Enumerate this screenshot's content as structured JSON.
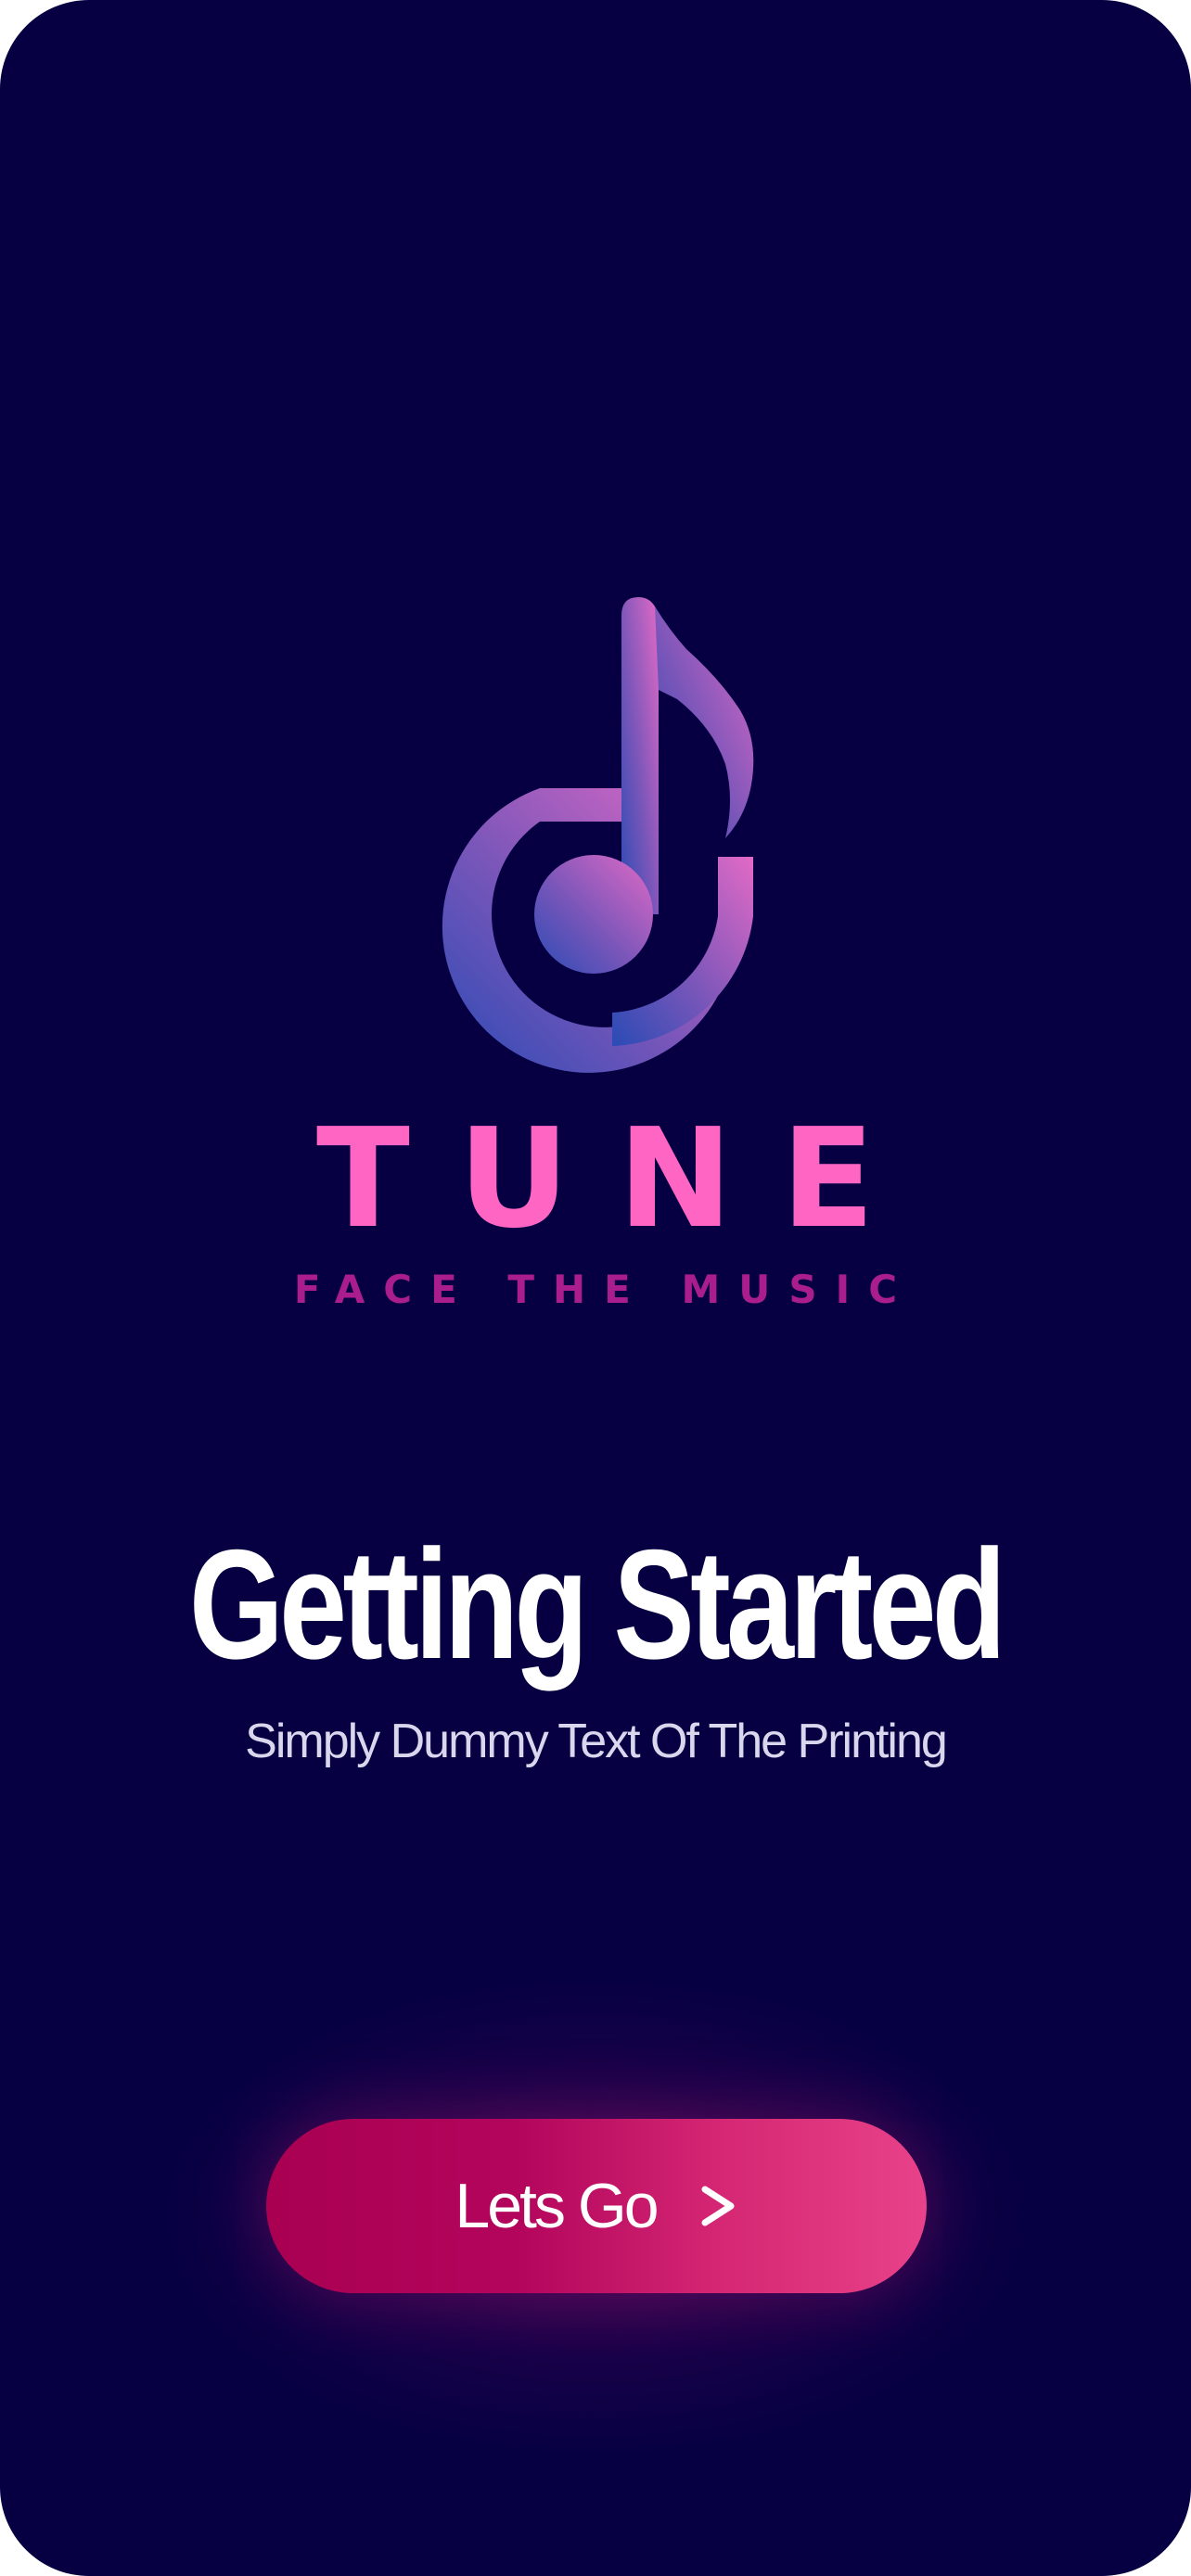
{
  "brand": {
    "icon": "music-note-logo",
    "name": "TUNE",
    "tagline": "FACE THE MUSIC"
  },
  "onboarding": {
    "title": "Getting Started",
    "subtitle": "Simply Dummy Text Of The Printing"
  },
  "cta": {
    "label": "Lets Go",
    "icon": "chevron-right-icon"
  },
  "colors": {
    "background": "#060042",
    "brand_pink": "#ff66c4",
    "tagline_magenta": "#a91d8e",
    "button_start": "#a90052",
    "button_end": "#e8428a",
    "logo_gradient_start": "#2a4bb5",
    "logo_gradient_end": "#d368c0"
  }
}
